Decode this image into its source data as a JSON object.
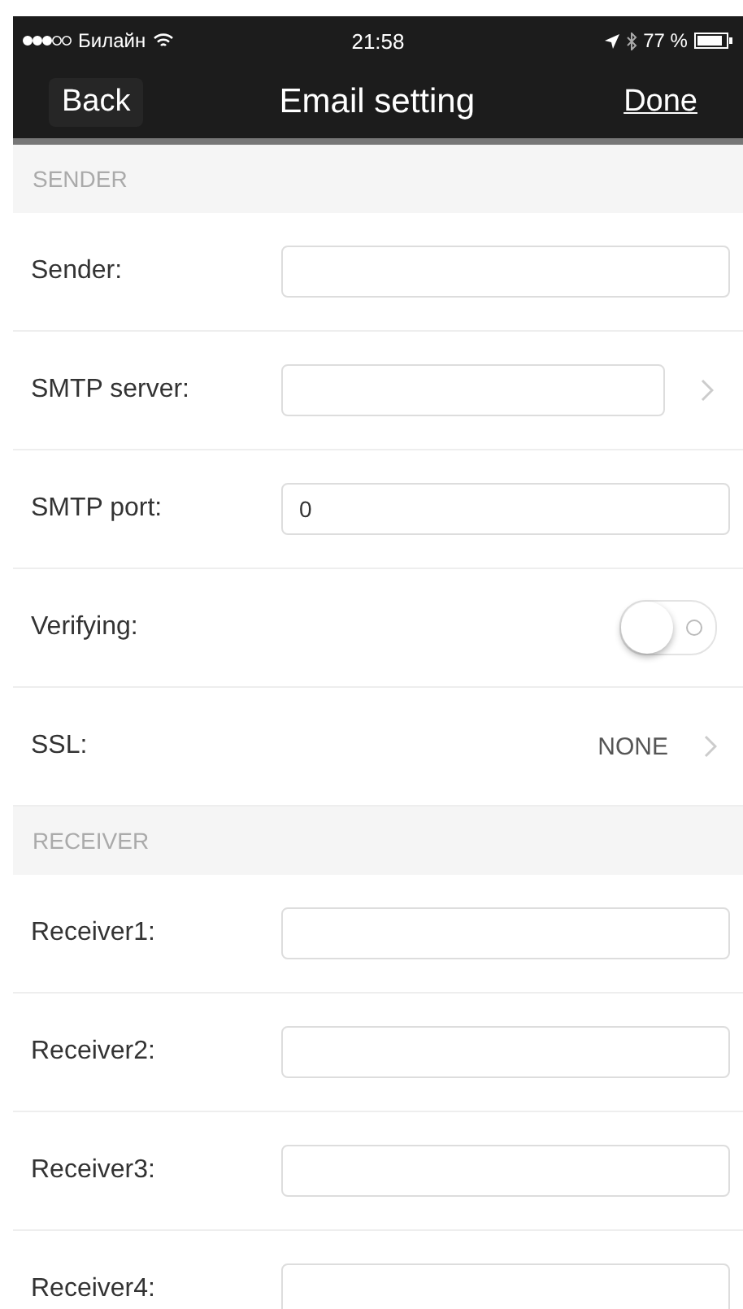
{
  "status_bar": {
    "carrier": "Билайн",
    "time": "21:58",
    "battery": "77 %"
  },
  "nav": {
    "back": "Back",
    "title": "Email setting",
    "done": "Done"
  },
  "sections": [
    {
      "header": "SENDER",
      "rows": [
        {
          "kind": "input",
          "label": "Sender:",
          "value": "",
          "chevron": false
        },
        {
          "kind": "input",
          "label": "SMTP server:",
          "value": "",
          "chevron": true
        },
        {
          "kind": "input",
          "label": "SMTP port:",
          "value": "0",
          "chevron": false
        },
        {
          "kind": "toggle",
          "label": "Verifying:",
          "on": false
        },
        {
          "kind": "select",
          "label": "SSL:",
          "value": "NONE"
        }
      ]
    },
    {
      "header": "RECEIVER",
      "rows": [
        {
          "kind": "input",
          "label": "Receiver1:",
          "value": "",
          "chevron": false
        },
        {
          "kind": "input",
          "label": "Receiver2:",
          "value": "",
          "chevron": false
        },
        {
          "kind": "input",
          "label": "Receiver3:",
          "value": "",
          "chevron": false
        },
        {
          "kind": "input",
          "label": "Receiver4:",
          "value": "",
          "chevron": false
        }
      ]
    }
  ]
}
